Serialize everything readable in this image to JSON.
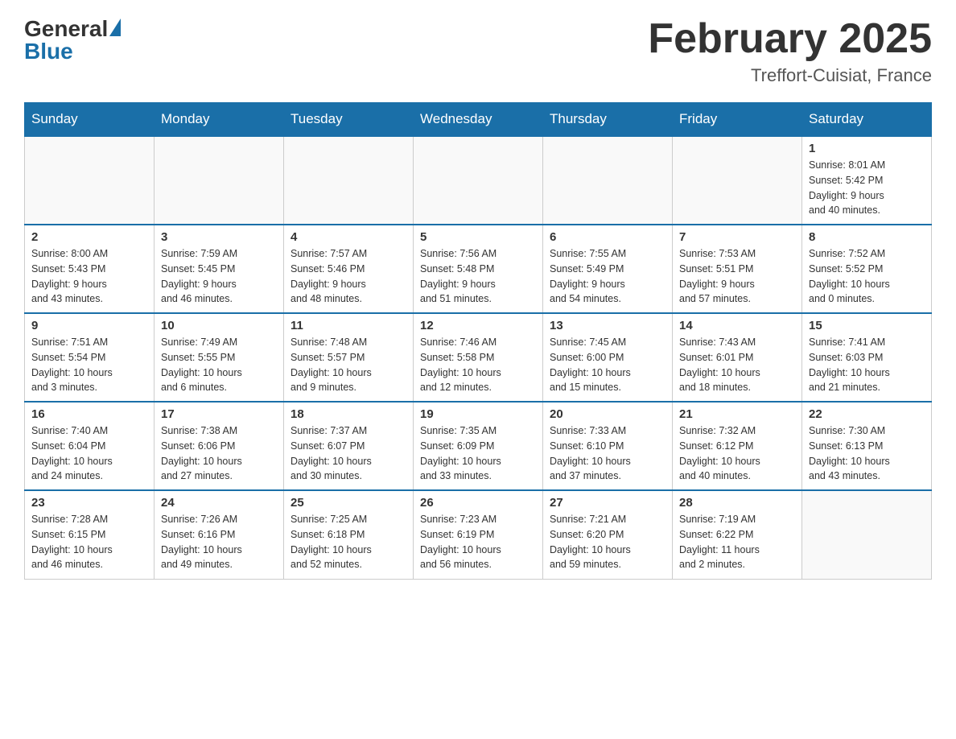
{
  "header": {
    "logo_general": "General",
    "logo_blue": "Blue",
    "title": "February 2025",
    "subtitle": "Treffort-Cuisiat, France"
  },
  "weekdays": [
    "Sunday",
    "Monday",
    "Tuesday",
    "Wednesday",
    "Thursday",
    "Friday",
    "Saturday"
  ],
  "weeks": [
    [
      {
        "day": "",
        "info": []
      },
      {
        "day": "",
        "info": []
      },
      {
        "day": "",
        "info": []
      },
      {
        "day": "",
        "info": []
      },
      {
        "day": "",
        "info": []
      },
      {
        "day": "",
        "info": []
      },
      {
        "day": "1",
        "info": [
          "Sunrise: 8:01 AM",
          "Sunset: 5:42 PM",
          "Daylight: 9 hours",
          "and 40 minutes."
        ]
      }
    ],
    [
      {
        "day": "2",
        "info": [
          "Sunrise: 8:00 AM",
          "Sunset: 5:43 PM",
          "Daylight: 9 hours",
          "and 43 minutes."
        ]
      },
      {
        "day": "3",
        "info": [
          "Sunrise: 7:59 AM",
          "Sunset: 5:45 PM",
          "Daylight: 9 hours",
          "and 46 minutes."
        ]
      },
      {
        "day": "4",
        "info": [
          "Sunrise: 7:57 AM",
          "Sunset: 5:46 PM",
          "Daylight: 9 hours",
          "and 48 minutes."
        ]
      },
      {
        "day": "5",
        "info": [
          "Sunrise: 7:56 AM",
          "Sunset: 5:48 PM",
          "Daylight: 9 hours",
          "and 51 minutes."
        ]
      },
      {
        "day": "6",
        "info": [
          "Sunrise: 7:55 AM",
          "Sunset: 5:49 PM",
          "Daylight: 9 hours",
          "and 54 minutes."
        ]
      },
      {
        "day": "7",
        "info": [
          "Sunrise: 7:53 AM",
          "Sunset: 5:51 PM",
          "Daylight: 9 hours",
          "and 57 minutes."
        ]
      },
      {
        "day": "8",
        "info": [
          "Sunrise: 7:52 AM",
          "Sunset: 5:52 PM",
          "Daylight: 10 hours",
          "and 0 minutes."
        ]
      }
    ],
    [
      {
        "day": "9",
        "info": [
          "Sunrise: 7:51 AM",
          "Sunset: 5:54 PM",
          "Daylight: 10 hours",
          "and 3 minutes."
        ]
      },
      {
        "day": "10",
        "info": [
          "Sunrise: 7:49 AM",
          "Sunset: 5:55 PM",
          "Daylight: 10 hours",
          "and 6 minutes."
        ]
      },
      {
        "day": "11",
        "info": [
          "Sunrise: 7:48 AM",
          "Sunset: 5:57 PM",
          "Daylight: 10 hours",
          "and 9 minutes."
        ]
      },
      {
        "day": "12",
        "info": [
          "Sunrise: 7:46 AM",
          "Sunset: 5:58 PM",
          "Daylight: 10 hours",
          "and 12 minutes."
        ]
      },
      {
        "day": "13",
        "info": [
          "Sunrise: 7:45 AM",
          "Sunset: 6:00 PM",
          "Daylight: 10 hours",
          "and 15 minutes."
        ]
      },
      {
        "day": "14",
        "info": [
          "Sunrise: 7:43 AM",
          "Sunset: 6:01 PM",
          "Daylight: 10 hours",
          "and 18 minutes."
        ]
      },
      {
        "day": "15",
        "info": [
          "Sunrise: 7:41 AM",
          "Sunset: 6:03 PM",
          "Daylight: 10 hours",
          "and 21 minutes."
        ]
      }
    ],
    [
      {
        "day": "16",
        "info": [
          "Sunrise: 7:40 AM",
          "Sunset: 6:04 PM",
          "Daylight: 10 hours",
          "and 24 minutes."
        ]
      },
      {
        "day": "17",
        "info": [
          "Sunrise: 7:38 AM",
          "Sunset: 6:06 PM",
          "Daylight: 10 hours",
          "and 27 minutes."
        ]
      },
      {
        "day": "18",
        "info": [
          "Sunrise: 7:37 AM",
          "Sunset: 6:07 PM",
          "Daylight: 10 hours",
          "and 30 minutes."
        ]
      },
      {
        "day": "19",
        "info": [
          "Sunrise: 7:35 AM",
          "Sunset: 6:09 PM",
          "Daylight: 10 hours",
          "and 33 minutes."
        ]
      },
      {
        "day": "20",
        "info": [
          "Sunrise: 7:33 AM",
          "Sunset: 6:10 PM",
          "Daylight: 10 hours",
          "and 37 minutes."
        ]
      },
      {
        "day": "21",
        "info": [
          "Sunrise: 7:32 AM",
          "Sunset: 6:12 PM",
          "Daylight: 10 hours",
          "and 40 minutes."
        ]
      },
      {
        "day": "22",
        "info": [
          "Sunrise: 7:30 AM",
          "Sunset: 6:13 PM",
          "Daylight: 10 hours",
          "and 43 minutes."
        ]
      }
    ],
    [
      {
        "day": "23",
        "info": [
          "Sunrise: 7:28 AM",
          "Sunset: 6:15 PM",
          "Daylight: 10 hours",
          "and 46 minutes."
        ]
      },
      {
        "day": "24",
        "info": [
          "Sunrise: 7:26 AM",
          "Sunset: 6:16 PM",
          "Daylight: 10 hours",
          "and 49 minutes."
        ]
      },
      {
        "day": "25",
        "info": [
          "Sunrise: 7:25 AM",
          "Sunset: 6:18 PM",
          "Daylight: 10 hours",
          "and 52 minutes."
        ]
      },
      {
        "day": "26",
        "info": [
          "Sunrise: 7:23 AM",
          "Sunset: 6:19 PM",
          "Daylight: 10 hours",
          "and 56 minutes."
        ]
      },
      {
        "day": "27",
        "info": [
          "Sunrise: 7:21 AM",
          "Sunset: 6:20 PM",
          "Daylight: 10 hours",
          "and 59 minutes."
        ]
      },
      {
        "day": "28",
        "info": [
          "Sunrise: 7:19 AM",
          "Sunset: 6:22 PM",
          "Daylight: 11 hours",
          "and 2 minutes."
        ]
      },
      {
        "day": "",
        "info": []
      }
    ]
  ]
}
